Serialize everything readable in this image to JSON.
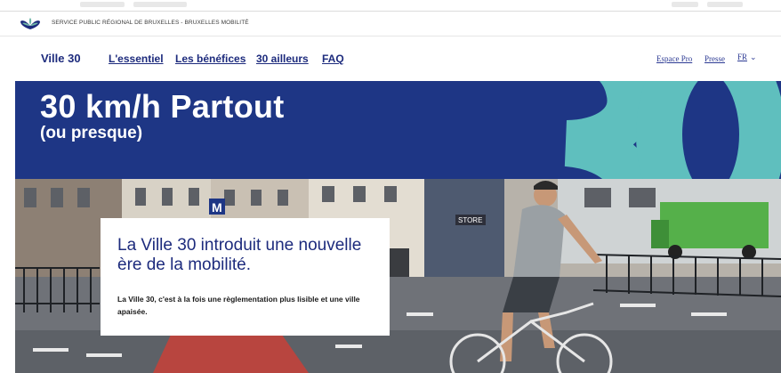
{
  "gov": {
    "text": "SERVICE PUBLIC RÉGIONAL DE BRUXELLES - BRUXELLES MOBILITÉ",
    "logo_icon": "brussels-iris-logo-icon"
  },
  "nav": {
    "brand": "Ville 30",
    "links": [
      "L'essentiel",
      "Les bénéfices",
      "30 ailleurs",
      "FAQ"
    ],
    "util": [
      "Espace Pro",
      "Presse"
    ],
    "lang": "FR",
    "lang_icon": "chevron-down-icon"
  },
  "hero": {
    "title": "30 km/h Partout",
    "subtitle": "(ou presque)",
    "big_number": "30"
  },
  "card": {
    "title": "La Ville 30 introduit une nouvelle ère de la mobilité.",
    "text": "La Ville 30, c'est à la fois une règlementation plus lisible et une ville apaisée."
  },
  "photo": {
    "store_sign": "STORE",
    "metro_sign": "M"
  },
  "colors": {
    "navy": "#1e3685",
    "link": "#1d2b7d",
    "teal": "#5fbfbe"
  }
}
